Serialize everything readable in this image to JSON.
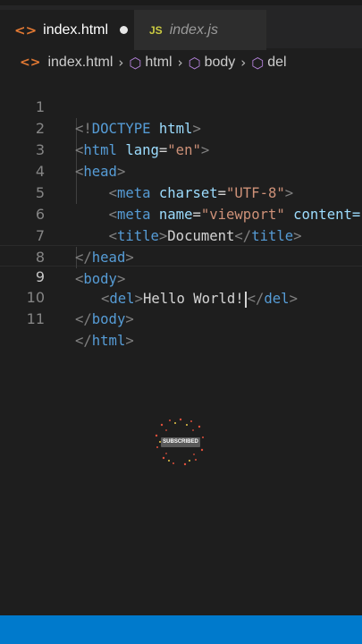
{
  "tabs": [
    {
      "label": "index.html",
      "icon": "html-file-icon",
      "active": true,
      "modified": true
    },
    {
      "label": "index.js",
      "icon": "js-file-icon",
      "active": false,
      "icon_text": "JS"
    }
  ],
  "breadcrumb": {
    "file": "index.html",
    "items": [
      "html",
      "body",
      "del"
    ]
  },
  "editor": {
    "current_line": 9,
    "lines": [
      {
        "n": "1"
      },
      {
        "n": "2"
      },
      {
        "n": "3"
      },
      {
        "n": "4"
      },
      {
        "n": "5"
      },
      {
        "n": "6"
      },
      {
        "n": "7"
      },
      {
        "n": "8"
      },
      {
        "n": "9"
      },
      {
        "n": "10"
      },
      {
        "n": "11"
      }
    ],
    "tokens": {
      "doctype": "DOCTYPE",
      "html": "html",
      "lang": "lang",
      "en": "\"en\"",
      "head": "head",
      "meta": "meta",
      "charset": "charset",
      "utf8": "\"UTF-8\"",
      "name": "name",
      "viewport": "\"viewport\"",
      "content": "content=",
      "title": "title",
      "document": "Document",
      "body": "body",
      "del": "del",
      "hello": "Hello World!"
    }
  },
  "overlay": {
    "subscribed_label": "SUBSCRIBED"
  },
  "colors": {
    "tag": "#569cd6",
    "attribute": "#9cdcfe",
    "string": "#ce9178",
    "punctuation": "#808080",
    "status_bar": "#007acc"
  }
}
